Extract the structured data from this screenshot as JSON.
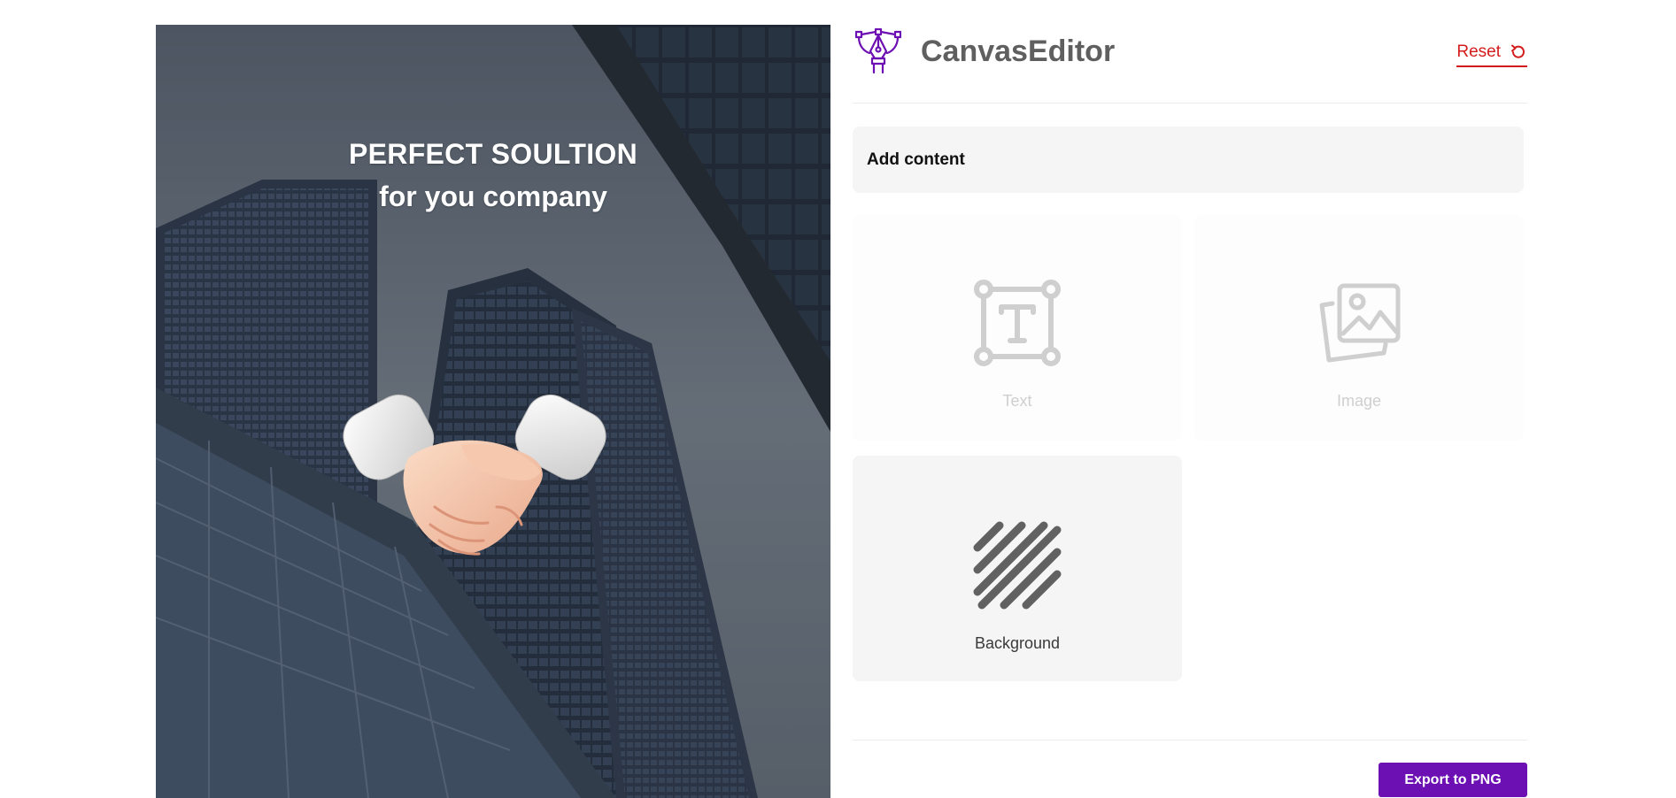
{
  "app": {
    "title": "CanvasEditor",
    "logo_icon": "pen-tool-icon",
    "accent_color": "#6c0fb3",
    "reset_label": "Reset",
    "reset_icon": "undo-icon",
    "reset_color": "#d41c1c"
  },
  "canvas": {
    "headline_line1": "PERFECT SOULTION",
    "headline_line2": "for you company",
    "background_image": "city-skyscrapers-photo",
    "sticker": "handshake-icon"
  },
  "panel": {
    "section_title": "Add content",
    "tiles": [
      {
        "label": "Text",
        "icon": "text-icon",
        "state": "disabled"
      },
      {
        "label": "Image",
        "icon": "image-icon",
        "state": "disabled"
      },
      {
        "label": "Background",
        "icon": "stripes-icon",
        "state": "active"
      }
    ],
    "export_label": "Export to PNG"
  }
}
